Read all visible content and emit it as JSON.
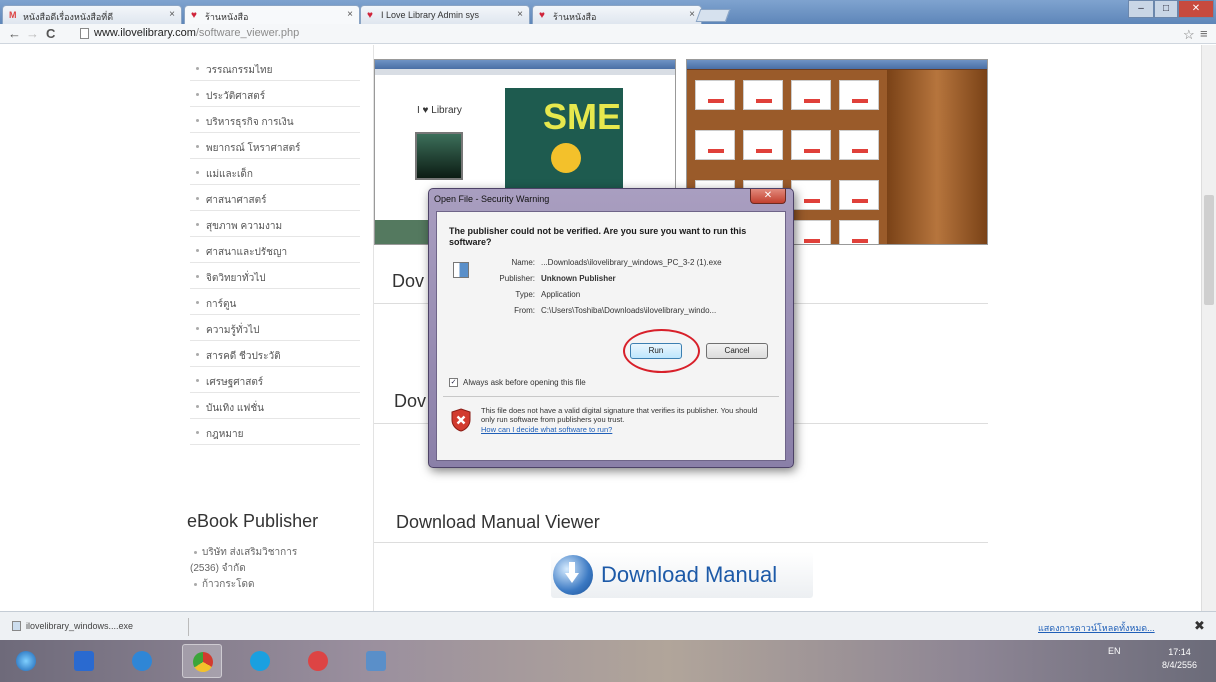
{
  "browser": {
    "tabs": [
      {
        "label": "หนังสือดีเรื่องหนังสือที่ดี"
      },
      {
        "label": "ร้านหนังสือ"
      },
      {
        "label": "I Love Library Admin sys"
      },
      {
        "label": "ร้านหนังสือ"
      }
    ],
    "url_domain": "www.ilovelibrary.com",
    "url_path": "/software_viewer.php"
  },
  "sidebar": {
    "categories": [
      "วรรณกรรมไทย",
      "ประวัติศาสตร์",
      "บริหารธุรกิจ การเงิน",
      "พยากรณ์ โหราศาสตร์",
      "แม่และเด็ก",
      "ศาสนาศาสตร์",
      "สุขภาพ ความงาม",
      "ศาสนาและปรัชญา",
      "จิตวิทยาทั่วไป",
      "การ์ตูน",
      "ความรู้ทั่วไป",
      "สารคดี ชีวประวัติ",
      "เศรษฐศาสตร์",
      "บันเทิง แฟชั่น",
      "กฎหมาย"
    ],
    "publisher_heading": "eBook Publisher",
    "publishers": [
      "บริษัท ส่งเสริมวิชาการ",
      "(2536) จำกัด",
      "ก้าวกระโดด"
    ]
  },
  "main": {
    "heading_partial_1": "Dov",
    "heading_partial_2": "Dov",
    "manual_heading": "Download Manual Viewer",
    "manual_button": "Download Manual",
    "preview_logo": "I ♥ Library",
    "preview_magazine": "SME"
  },
  "dialog": {
    "title": "Open File - Security Warning",
    "question": "The publisher could not be verified.  Are you sure you want to run this software?",
    "fields": [
      {
        "key": "Name:",
        "value": "...Downloads\\ilovelibrary_windows_PC_3-2 (1).exe"
      },
      {
        "key": "Publisher:",
        "value": "Unknown Publisher"
      },
      {
        "key": "Type:",
        "value": "Application"
      },
      {
        "key": "From:",
        "value": "C:\\Users\\Toshiba\\Downloads\\ilovelibrary_windo..."
      }
    ],
    "run_label": "Run",
    "cancel_label": "Cancel",
    "checkbox_label": "Always ask before opening this file",
    "checkbox_checked": true,
    "warning_text": "This file does not have a valid digital signature that verifies its publisher.  You should only run software from publishers you trust.",
    "warning_link": "How can I decide what software to run?"
  },
  "download_shelf": {
    "item": "ilovelibrary_windows....exe",
    "show_all": "แสดงการดาวน์โหลดทั้งหมด...",
    "close": "✖"
  },
  "taskbar": {
    "lang": "EN",
    "time": "17:14",
    "date": "8/4/2556"
  }
}
